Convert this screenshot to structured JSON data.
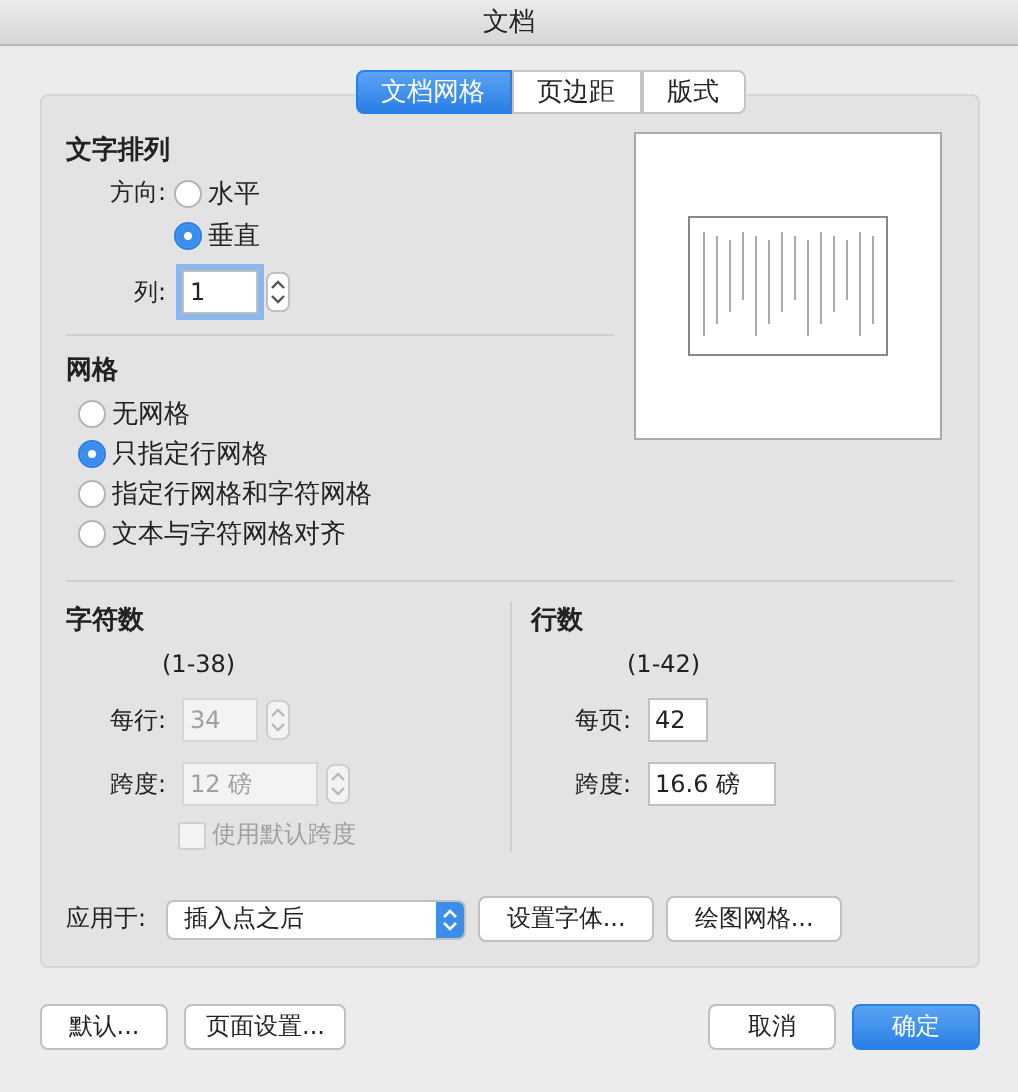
{
  "window": {
    "title": "文档"
  },
  "tabs": [
    {
      "label": "文档网格",
      "selected": true
    },
    {
      "label": "页边距",
      "selected": false
    },
    {
      "label": "版式",
      "selected": false
    }
  ],
  "text_direction": {
    "heading": "文字排列",
    "label": "方向:",
    "options": [
      {
        "label": "水平",
        "selected": false
      },
      {
        "label": "垂直",
        "selected": true
      }
    ],
    "columns_label": "列:",
    "columns_value": "1"
  },
  "grid": {
    "heading": "网格",
    "options": [
      {
        "label": "无网格",
        "selected": false
      },
      {
        "label": "只指定行网格",
        "selected": true
      },
      {
        "label": "指定行网格和字符网格",
        "selected": false
      },
      {
        "label": "文本与字符网格对齐",
        "selected": false
      }
    ]
  },
  "characters": {
    "heading": "字符数",
    "range": "(1-38)",
    "disabled": true,
    "per_line_label": "每行:",
    "per_line_value": "34",
    "pitch_label": "跨度:",
    "pitch_value": "12 磅",
    "use_default": {
      "label": "使用默认跨度",
      "checked": false
    }
  },
  "lines": {
    "heading": "行数",
    "range": "(1-42)",
    "per_page_label": "每页:",
    "per_page_value": "42",
    "pitch_label": "跨度:",
    "pitch_value": "16.6 磅"
  },
  "apply_to": {
    "label": "应用于:",
    "value": "插入点之后"
  },
  "panel_buttons": [
    "设置字体...",
    "绘图网格..."
  ],
  "footer_buttons": [
    {
      "label": "默认...",
      "kind": "plain"
    },
    {
      "label": "页面设置...",
      "kind": "plain"
    },
    {
      "label": "取消",
      "kind": "plain"
    },
    {
      "label": "确定",
      "kind": "default"
    }
  ]
}
